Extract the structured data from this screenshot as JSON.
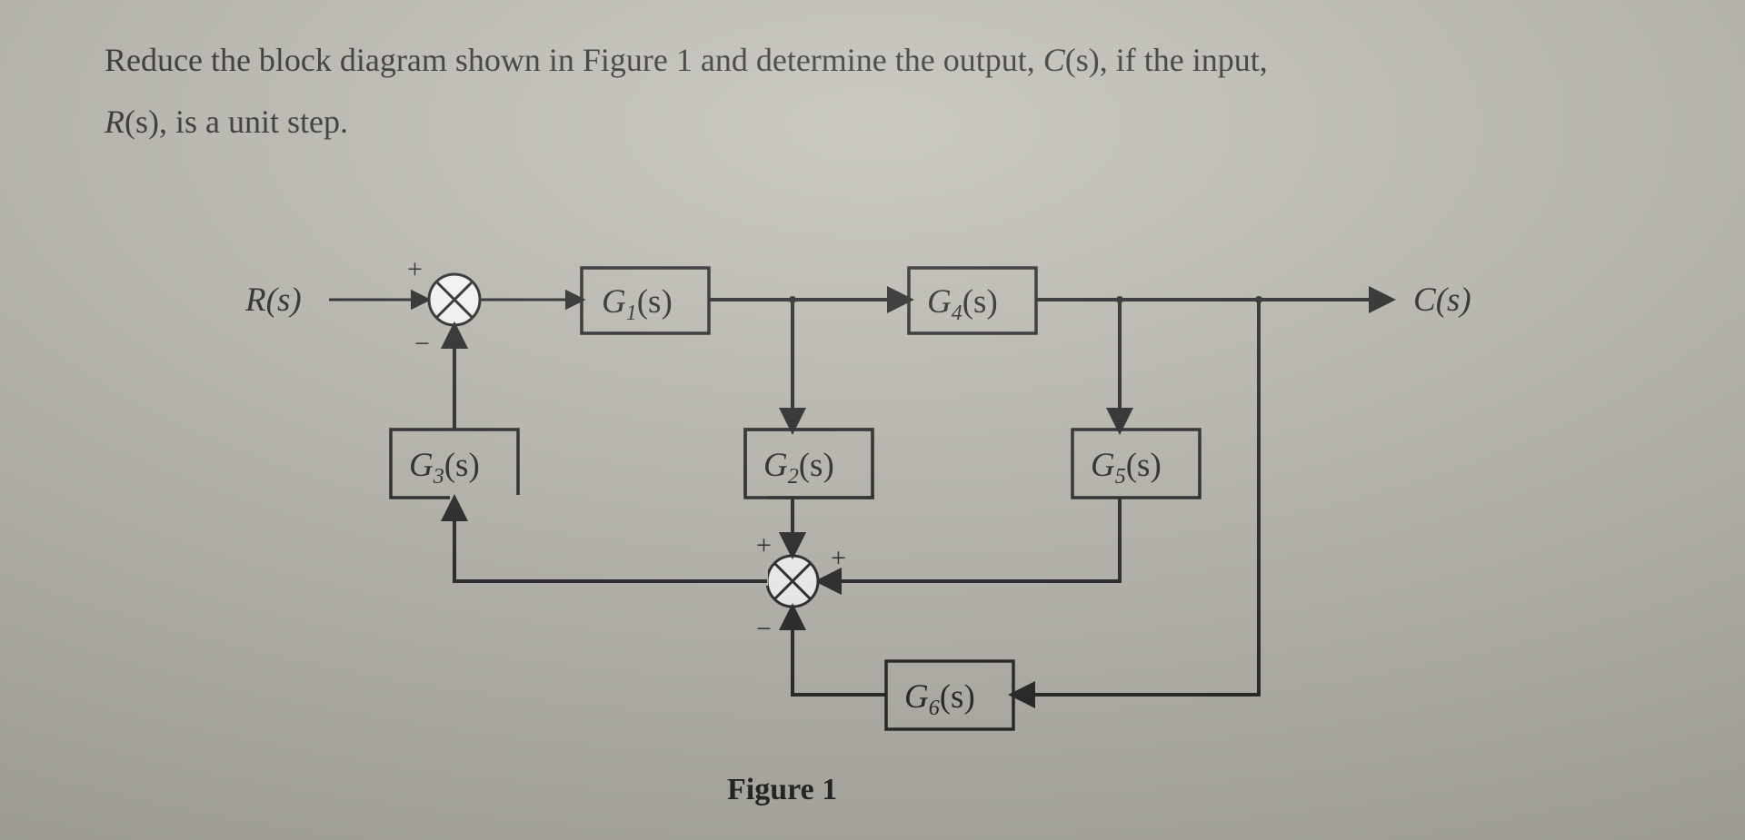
{
  "problem": {
    "line1_pre": "Reduce the block diagram shown in Figure 1 and determine the output, ",
    "line1_C": "C",
    "line1_paren_s": "(s)",
    "line1_post": ", if the input,",
    "line2_R": "R",
    "line2_paren_s": "(s)",
    "line2_post": ", is a unit step."
  },
  "diagram": {
    "input_label": "R(s)",
    "output_label": "C(s)",
    "caption": "Figure 1",
    "sum1": {
      "top_sign": "+",
      "bottom_sign": "−"
    },
    "sum2": {
      "left_sign": "+",
      "right_sign": "+",
      "bottom_sign": "−"
    },
    "blocks": {
      "G1": {
        "name": "G",
        "sub": "1",
        "arg": "(s)"
      },
      "G2": {
        "name": "G",
        "sub": "2",
        "arg": "(s)"
      },
      "G3": {
        "name": "G",
        "sub": "3",
        "arg": "(s)"
      },
      "G4": {
        "name": "G",
        "sub": "4",
        "arg": "(s)"
      },
      "G5": {
        "name": "G",
        "sub": "5",
        "arg": "(s)"
      },
      "G6": {
        "name": "G",
        "sub": "6",
        "arg": "(s)"
      }
    }
  }
}
